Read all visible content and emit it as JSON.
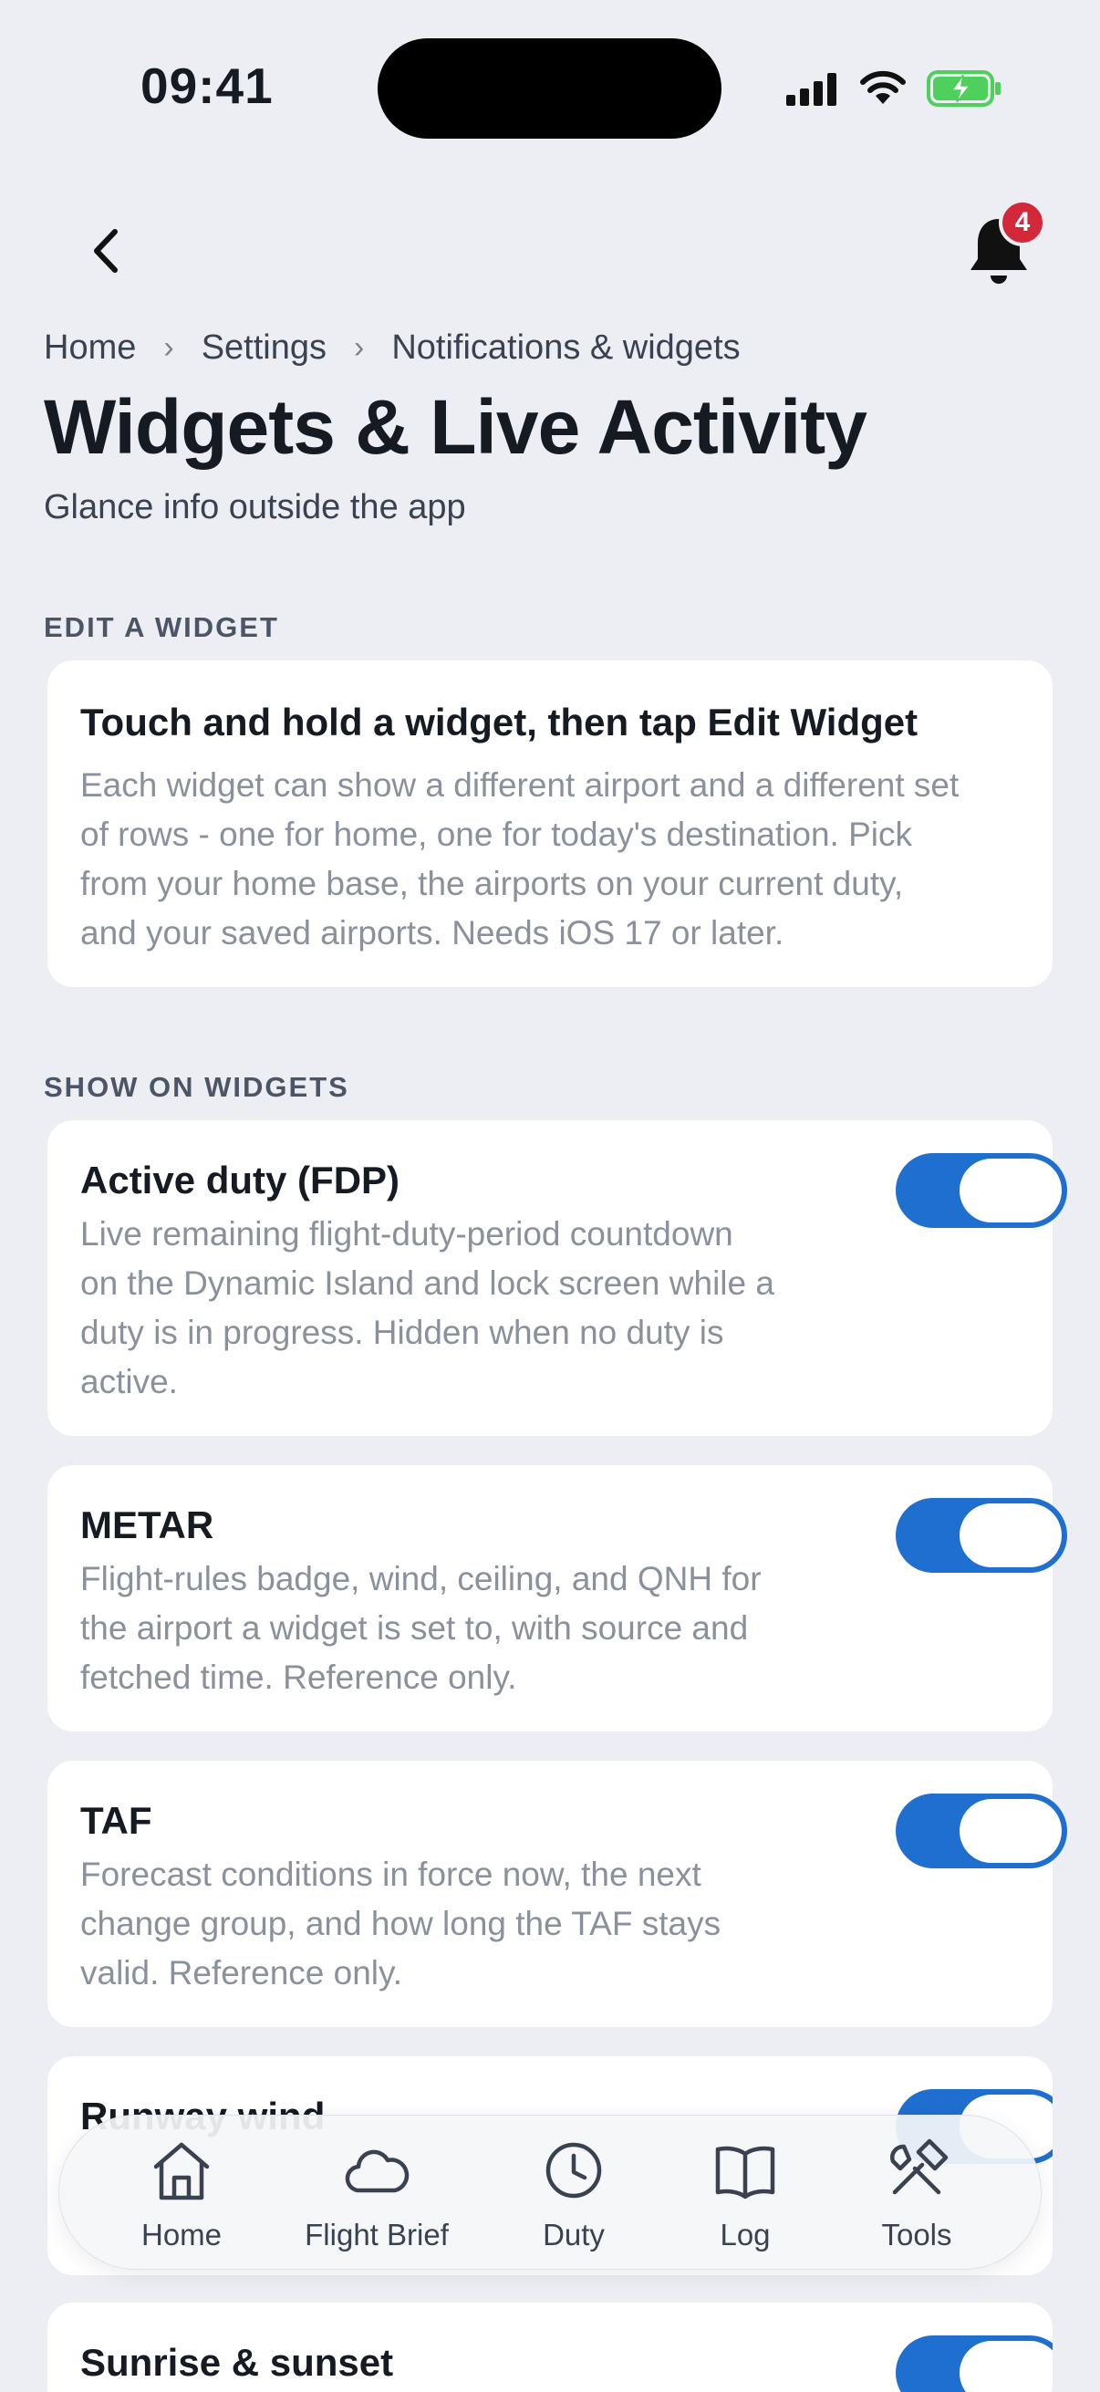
{
  "status_bar": {
    "time": "09:41",
    "icons": [
      "signal-icon",
      "wifi-icon",
      "battery-charging-icon"
    ]
  },
  "header": {
    "notification_count": "4"
  },
  "breadcrumb": [
    "Home",
    "Settings",
    "Notifications & widgets"
  ],
  "page": {
    "title": "Widgets & Live Activity",
    "subtitle": "Glance info outside the app"
  },
  "edit_widget": {
    "section_label": "EDIT A WIDGET",
    "title": "Touch and hold a widget, then tap Edit Widget",
    "desc_lines": [
      "Each widget can show a different airport and a different set",
      "of rows - one for home, one for today's destination. Pick",
      "from your home base, the airports on your current duty,",
      "and your saved airports. Needs iOS 17 or later."
    ]
  },
  "show_on_widgets": {
    "section_label": "SHOW ON WIDGETS",
    "items": [
      {
        "title": "Active duty (FDP)",
        "enabled": true,
        "desc_lines": [
          "Live remaining flight-duty-period countdown",
          "on the Dynamic Island and lock screen while a",
          "duty is in progress. Hidden when no duty is",
          "active."
        ]
      },
      {
        "title": "METAR",
        "enabled": true,
        "desc_lines": [
          "Flight-rules badge, wind, ceiling, and QNH for",
          "the airport a widget is set to, with source and",
          "fetched time. Reference only."
        ]
      },
      {
        "title": "TAF",
        "enabled": true,
        "desc_lines": [
          "Forecast conditions in force now, the next",
          "change group, and how long the TAF stays",
          "valid. Reference only."
        ]
      },
      {
        "title": "Runway wind",
        "enabled": true,
        "desc_lines": []
      },
      {
        "title": "Sunrise & sunset",
        "enabled": true,
        "desc_lines": []
      }
    ]
  },
  "tab_bar": {
    "tabs": [
      {
        "label": "Home",
        "icon": "home-icon"
      },
      {
        "label": "Flight Brief",
        "icon": "cloud-icon"
      },
      {
        "label": "Duty",
        "icon": "clock-icon"
      },
      {
        "label": "Log",
        "icon": "book-icon"
      },
      {
        "label": "Tools",
        "icon": "tools-icon"
      }
    ]
  },
  "colors": {
    "accent": "#1e6fd0",
    "badge": "#d3273a",
    "background": "#eceef3"
  }
}
